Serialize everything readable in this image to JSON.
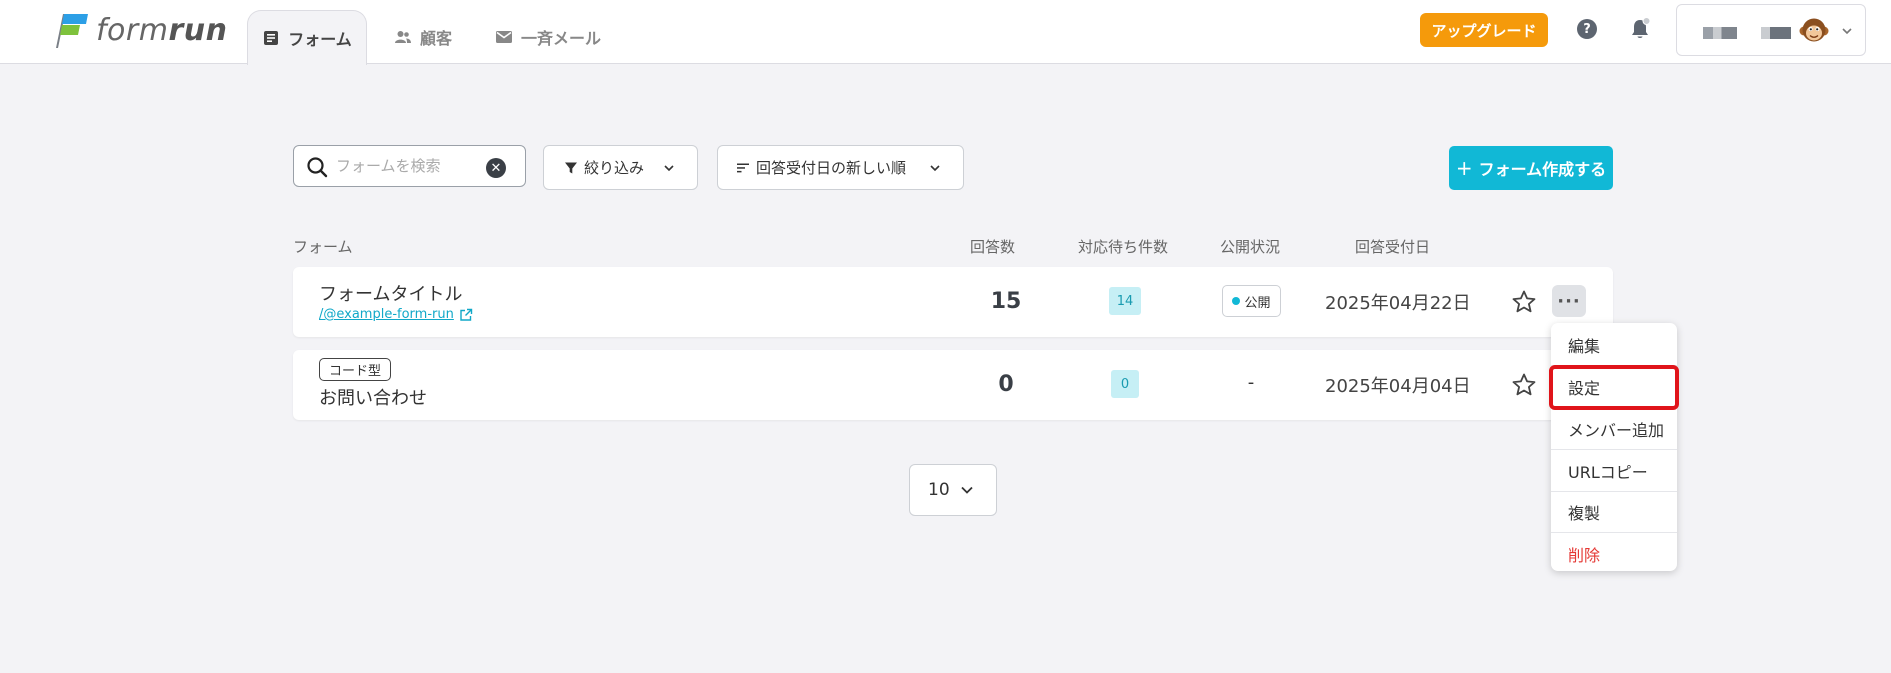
{
  "header": {
    "logo_text": "formrun",
    "tabs": [
      {
        "label": "フォーム",
        "active": true
      },
      {
        "label": "顧客",
        "active": false
      },
      {
        "label": "一斉メール",
        "active": false
      }
    ],
    "upgrade_label": "アップグレード",
    "help_glyph": "?"
  },
  "toolbar": {
    "search_placeholder": "フォームを検索",
    "filter_label": "絞り込み",
    "sort_label": "回答受付日の新しい順",
    "create_label": "フォーム作成する",
    "create_plus": "+"
  },
  "table": {
    "columns": [
      "フォーム",
      "回答数",
      "対応待ち件数",
      "公開状況",
      "回答受付日"
    ],
    "rows": [
      {
        "title": "フォームタイトル",
        "link": "/@example-form-run",
        "tag": "",
        "responses": "15",
        "pending": "14",
        "status": "公開",
        "date": "2025年04月22日"
      },
      {
        "title": "お問い合わせ",
        "link": "",
        "tag": "コード型",
        "responses": "0",
        "pending": "0",
        "status": "-",
        "date": "2025年04月04日"
      }
    ]
  },
  "more_glyph": "···",
  "menu": {
    "items": [
      "編集",
      "設定",
      "メンバー追加",
      "URLコピー",
      "複製",
      "削除"
    ],
    "highlighted": "設定"
  },
  "pagination": {
    "per_page": "10"
  },
  "colors": {
    "accent": "#11b8d6",
    "upgrade": "#f59a0b",
    "danger": "#e53935",
    "highlight_border": "#e0141a"
  }
}
